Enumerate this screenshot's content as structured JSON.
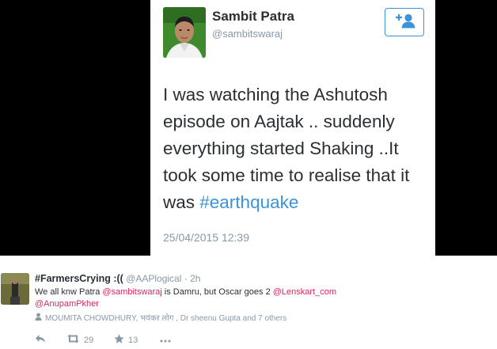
{
  "tweet": {
    "author_name": "Sambit Patra",
    "author_handle": "@sambitswaraj",
    "text_before": "I was watching the Ashutosh episode on Aajtak .. suddenly everything started Shaking ..It took some time to realise that it was ",
    "hashtag": "#earthquake",
    "timestamp": "25/04/2015 12:39",
    "follow_icon": "add-user-icon",
    "accent_color": "#3b94d9"
  },
  "reply": {
    "name": "#FarmersCrying :((",
    "handle": "@AAPlogical",
    "separator": "·",
    "time": "2h",
    "body_start": "We all knw Patra ",
    "mention1": "@sambitswaraj",
    "body_mid": " is Damru, but Oscar goes 2 ",
    "mention2": "@Lenskart_com",
    "mention3": "@AnupamPkher",
    "social_context": "MOUMITA CHOWDHURY, भयंकर लोग , Dr sheenu Gupta and 7 others",
    "retweet_count": "29",
    "favorite_count": "13",
    "mention_color": "#e0245e"
  }
}
